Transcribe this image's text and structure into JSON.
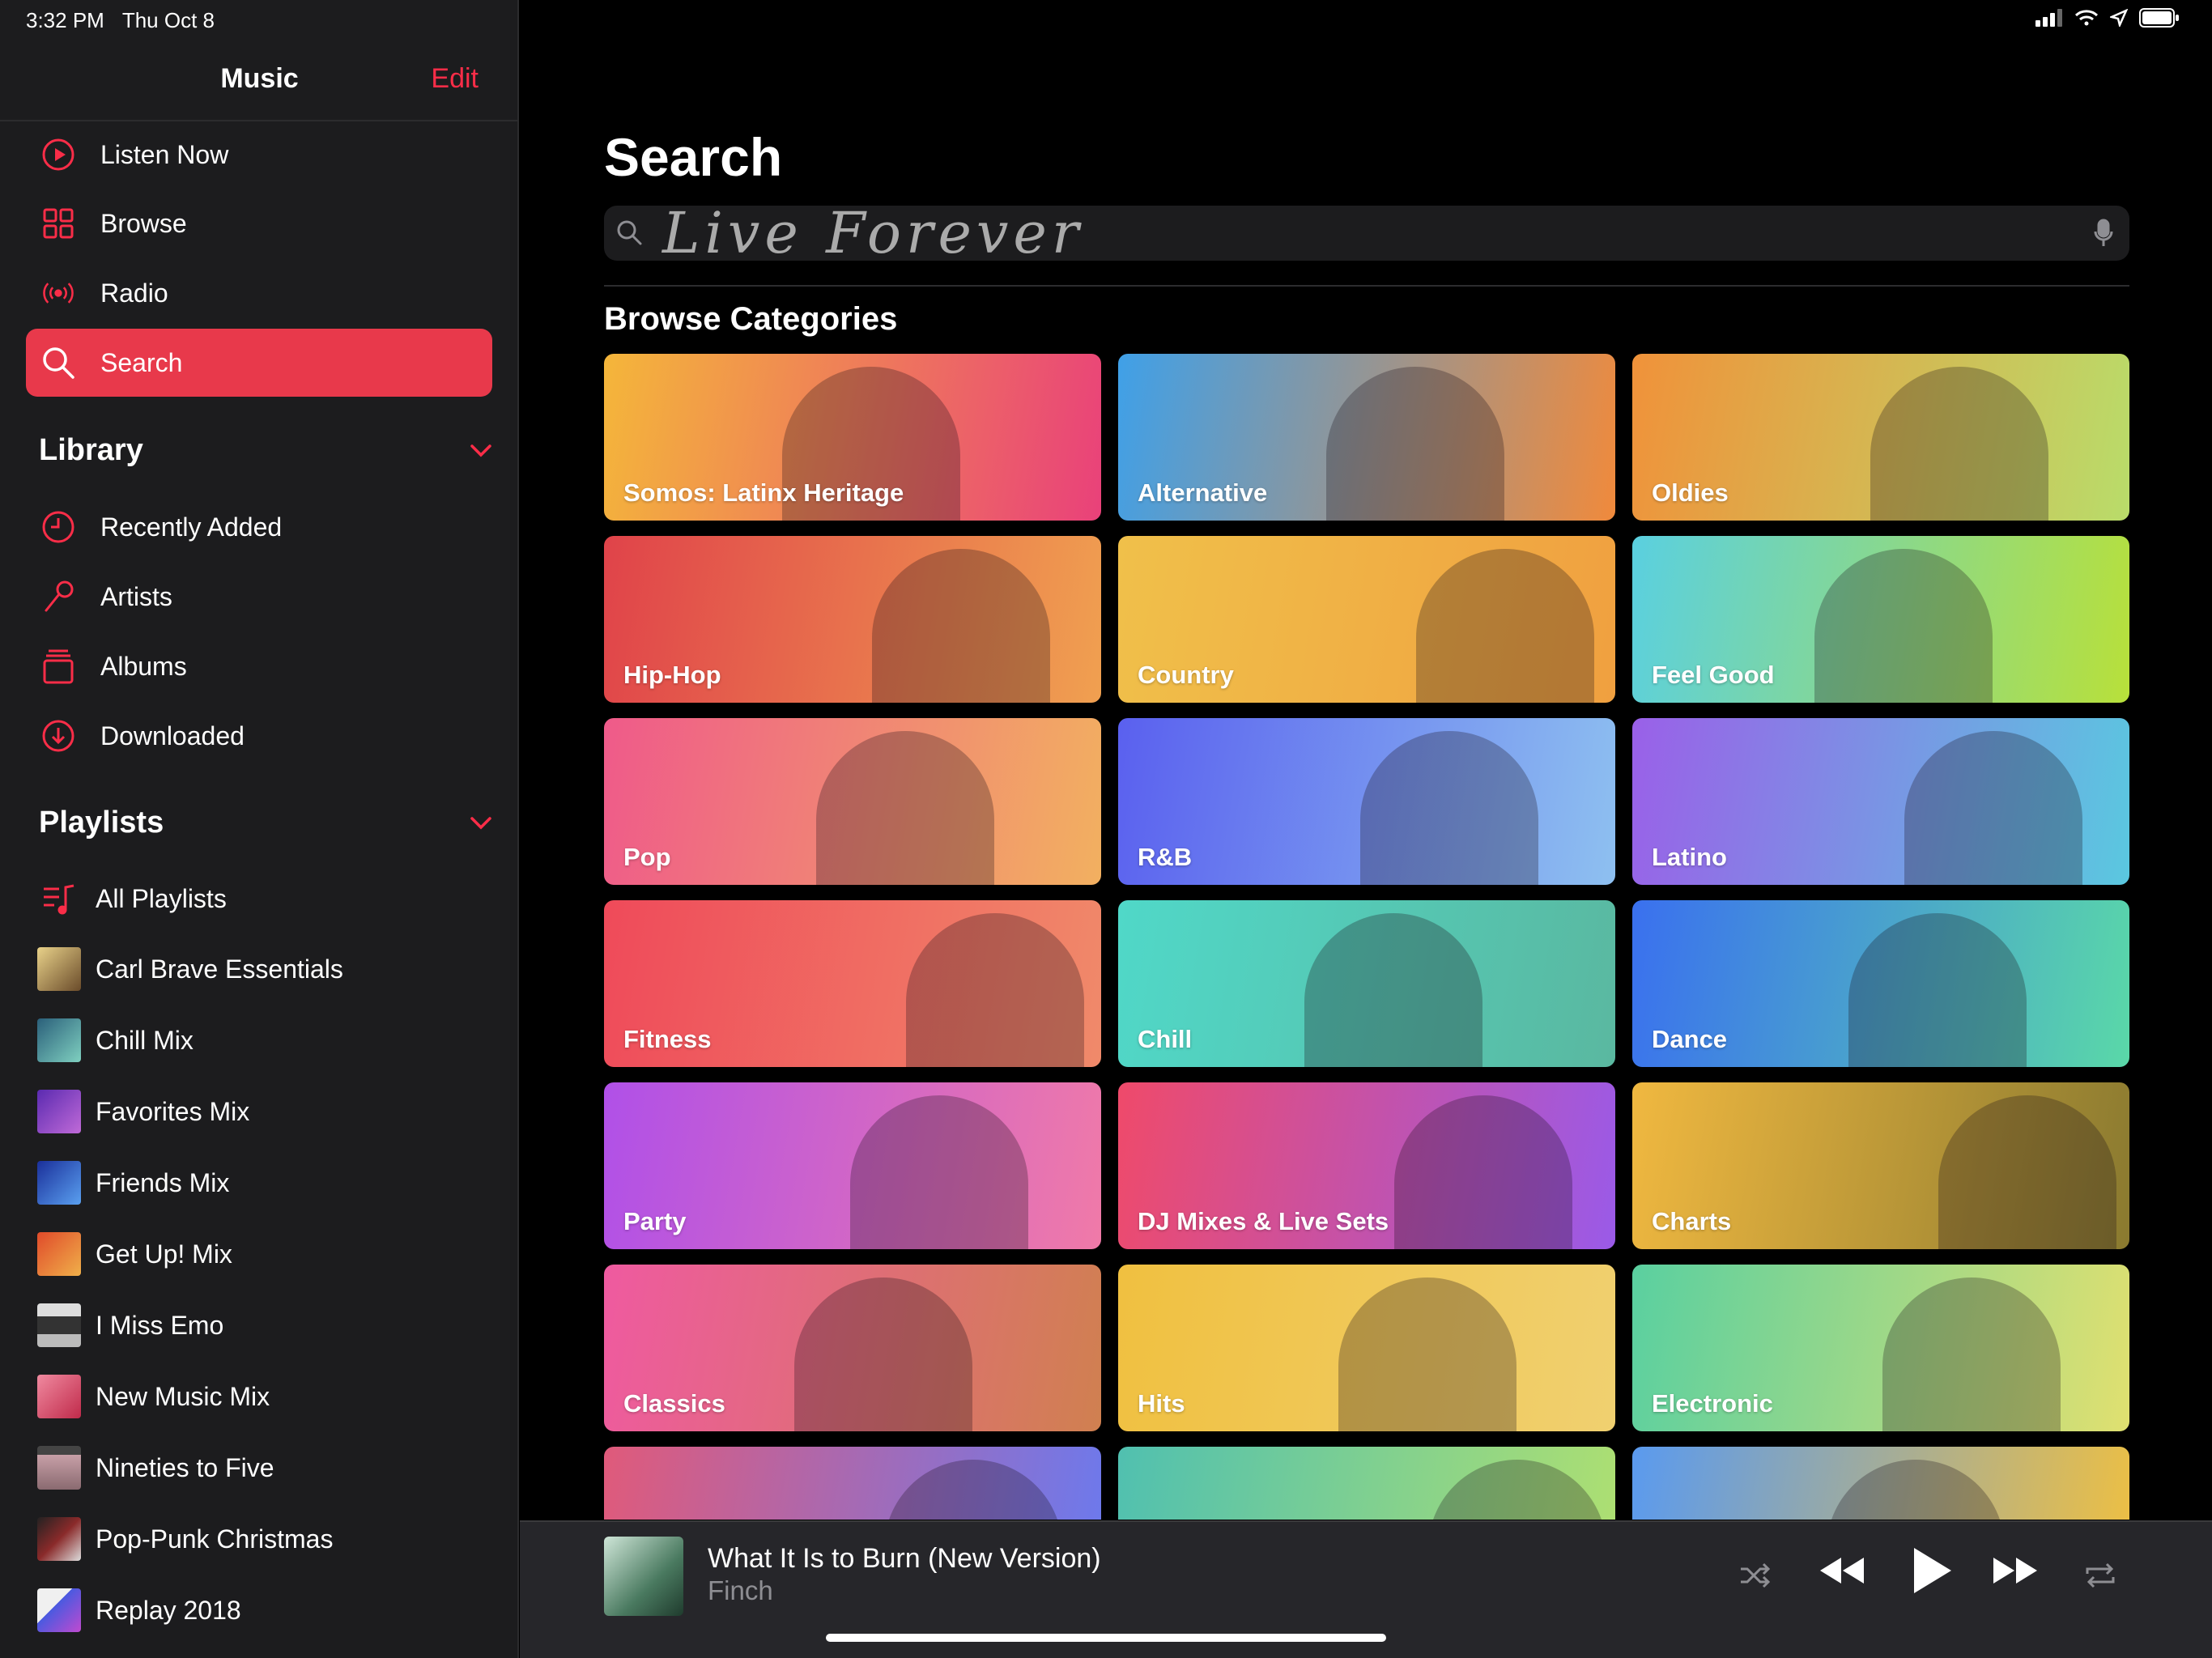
{
  "status": {
    "time": "3:32 PM",
    "date": "Thu Oct 8"
  },
  "sidebar": {
    "title": "Music",
    "edit": "Edit",
    "nav": [
      {
        "label": "Listen Now",
        "icon": "play-circle-icon"
      },
      {
        "label": "Browse",
        "icon": "grid-icon"
      },
      {
        "label": "Radio",
        "icon": "radio-icon"
      },
      {
        "label": "Search",
        "icon": "search-icon",
        "active": true
      }
    ],
    "library_title": "Library",
    "library": [
      {
        "label": "Recently Added",
        "icon": "clock-icon"
      },
      {
        "label": "Artists",
        "icon": "microphone-icon"
      },
      {
        "label": "Albums",
        "icon": "album-stack-icon"
      },
      {
        "label": "Downloaded",
        "icon": "download-icon"
      }
    ],
    "playlists_title": "Playlists",
    "playlists": [
      {
        "label": "All Playlists",
        "icon": "playlist-icon"
      },
      {
        "label": "Carl Brave Essentials",
        "color": "#c9a15a"
      },
      {
        "label": "Chill Mix",
        "color": "#4aa7a8"
      },
      {
        "label": "Favorites Mix",
        "color": "#7a4fd1"
      },
      {
        "label": "Friends Mix",
        "color": "#2b5fc9"
      },
      {
        "label": "Get Up! Mix",
        "color": "#e2703a"
      },
      {
        "label": "I Miss Emo",
        "color": "#5a5a5a"
      },
      {
        "label": "New Music Mix",
        "color": "#e0506a"
      },
      {
        "label": "Nineties to Five",
        "color": "#9a7f86"
      },
      {
        "label": "Pop-Punk Christmas",
        "color": "#7a2a2a"
      },
      {
        "label": "Replay 2018",
        "color": "#3a5ad8"
      }
    ]
  },
  "main": {
    "title": "Search",
    "search_value": "Live Forever",
    "section_title": "Browse Categories",
    "categories": [
      {
        "label": "Somos: Latinx Heritage",
        "c1": "#f4b63a",
        "c2": "#e9417a"
      },
      {
        "label": "Alternative",
        "c1": "#3fa0e8",
        "c2": "#f08a3c"
      },
      {
        "label": "Oldies",
        "c1": "#f0923a",
        "c2": "#b9dc6a"
      },
      {
        "label": "Hip-Hop",
        "c1": "#e0434a",
        "c2": "#f0a050"
      },
      {
        "label": "Country",
        "c1": "#f0c04a",
        "c2": "#f0a040"
      },
      {
        "label": "Feel Good",
        "c1": "#5ad0e0",
        "c2": "#b8e03a"
      },
      {
        "label": "Pop",
        "c1": "#ef5a8a",
        "c2": "#f2b060"
      },
      {
        "label": "R&B",
        "c1": "#5a60ef",
        "c2": "#8ec0f0"
      },
      {
        "label": "Latino",
        "c1": "#9a60e8",
        "c2": "#5ac8e0"
      },
      {
        "label": "Fitness",
        "c1": "#ef4a5a",
        "c2": "#f08a6a"
      },
      {
        "label": "Chill",
        "c1": "#50d8c8",
        "c2": "#5ab8a0"
      },
      {
        "label": "Dance",
        "c1": "#3a70ef",
        "c2": "#5ad8a8"
      },
      {
        "label": "Party",
        "c1": "#b050e8",
        "c2": "#f07aa8"
      },
      {
        "label": "DJ Mixes & Live Sets",
        "c1": "#ef4a6a",
        "c2": "#9a5ae8"
      },
      {
        "label": "Charts",
        "c1": "#f0b840",
        "c2": "#8a7a30"
      },
      {
        "label": "Classics",
        "c1": "#ef5aa0",
        "c2": "#d08050"
      },
      {
        "label": "Hits",
        "c1": "#f0c040",
        "c2": "#f0d070"
      },
      {
        "label": "Electronic",
        "c1": "#5ad0a0",
        "c2": "#e0e070"
      },
      {
        "label": "",
        "c1": "#e05a7a",
        "c2": "#6a7aef"
      },
      {
        "label": "",
        "c1": "#50c0b0",
        "c2": "#b0e070"
      },
      {
        "label": "",
        "c1": "#5a9aef",
        "c2": "#f0c040"
      }
    ]
  },
  "player": {
    "title": "What It Is to Burn (New Version)",
    "artist": "Finch"
  },
  "colors": {
    "accent": "#fa2d48",
    "sidebar_bg": "#1c1c1e",
    "background": "#000000"
  }
}
